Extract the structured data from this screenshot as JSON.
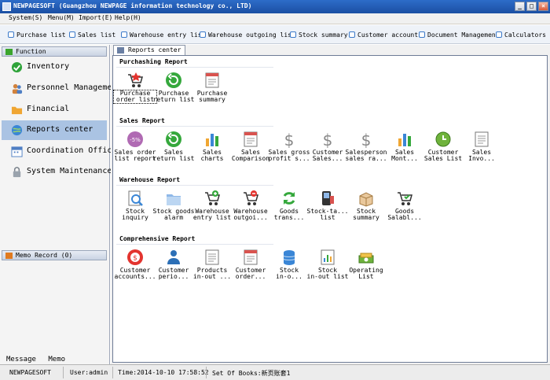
{
  "window": {
    "title": "NEWPAGESOFT (Guangzhou NEWPAGE information technology co., LTD)",
    "minimize": "_",
    "maximize": "□",
    "close": "×"
  },
  "menu": [
    "System(S)",
    "Menu(M)",
    "Import(E)",
    "Help(H)"
  ],
  "toolbar": [
    "Purchase list",
    "Sales list",
    "Warehouse entry list",
    "Warehouse outgoing list",
    "Stock summary",
    "Customer accounts",
    "Document Management",
    "Calculators"
  ],
  "sidebar": {
    "function_header": "Function",
    "items": [
      "Inventory",
      "Personnel Management",
      "Financial",
      "Reports center",
      "Coordination Office",
      "System Maintenance"
    ],
    "memo_header": "Memo Record (0)",
    "bottom": [
      "Message",
      "Memo"
    ]
  },
  "tab": "Reports center",
  "sections": [
    {
      "title": "Purchashing Report",
      "items": [
        "Purchase\norder list",
        "Purchase\nreturn list",
        "Purchase\nsummary"
      ]
    },
    {
      "title": "Sales Report",
      "items": [
        "Sales order\nlist report",
        "Sales\nreturn list",
        "Sales\ncharts",
        "Sales\nComparison",
        "Sales gross\nprofit s...",
        "Customer\nSales...",
        "Salesperson\nsales ra...",
        "Sales\nMont...",
        "Customer\nSales List",
        "Sales\nInvo..."
      ]
    },
    {
      "title": "Warehouse Report",
      "items": [
        "Stock\ninquiry",
        "Stock goods\nalarm",
        "Warehouse\nentry list",
        "Warehouse\noutgoi...",
        "Goods\ntrans...",
        "Stock-ta...\nlist",
        "Stock\nsummary",
        "Goods\nSalabl..."
      ]
    },
    {
      "title": "Comprehensive Report",
      "items": [
        "Customer\naccounts...",
        "Customer\nperio...",
        "Products\nin-out ...",
        "Customer\norder...",
        "Stock\nin-o...",
        "Stock\nin-out list",
        "Operating\nList"
      ]
    }
  ],
  "status": {
    "app": "NEWPAGESOFT",
    "user": "User:admin",
    "time": "Time:2014-10-10 17:58:52",
    "books": "Set Of Books:新页账套1"
  },
  "colors": {
    "titlebar": "#1b4fa3",
    "accent": "#3b79c9",
    "selected_item": "#aac3e3"
  }
}
